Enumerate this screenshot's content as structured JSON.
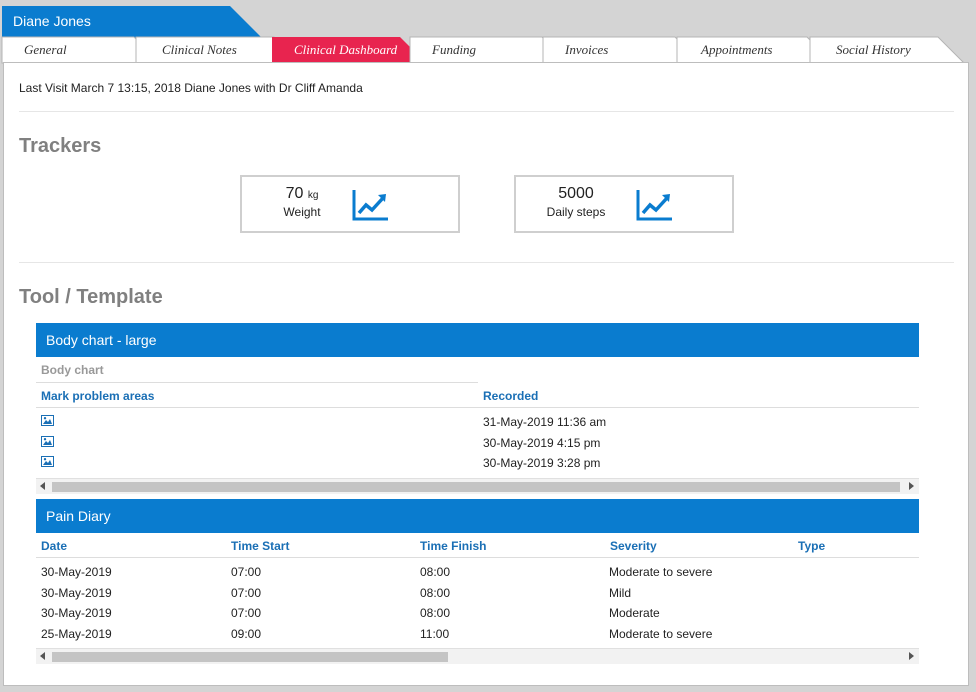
{
  "patient_name": "Diane Jones",
  "tabs": [
    {
      "label": "General",
      "active": false
    },
    {
      "label": "Clinical Notes",
      "active": false
    },
    {
      "label": "Clinical Dashboard",
      "active": true
    },
    {
      "label": "Funding",
      "active": false
    },
    {
      "label": "Invoices",
      "active": false
    },
    {
      "label": "Appointments",
      "active": false
    },
    {
      "label": "Social History",
      "active": false
    }
  ],
  "last_visit": "Last Visit March 7 13:15, 2018 Diane Jones with Dr Cliff Amanda",
  "trackers_title": "Trackers",
  "trackers": [
    {
      "value": "70",
      "unit": "kg",
      "label": "Weight",
      "icon": "line-chart-icon"
    },
    {
      "value": "5000",
      "unit": "",
      "label": "Daily steps",
      "icon": "line-chart-icon"
    }
  ],
  "tool_title": "Tool / Template",
  "body_chart": {
    "header": "Body chart - large",
    "subheader": "Body chart",
    "columns": [
      "Mark problem areas",
      "Recorded"
    ],
    "rows": [
      {
        "icon": "image-icon",
        "recorded": "31-May-2019 11:36 am"
      },
      {
        "icon": "image-icon",
        "recorded": "30-May-2019 4:15 pm"
      },
      {
        "icon": "image-icon",
        "recorded": "30-May-2019 3:28 pm"
      }
    ]
  },
  "pain_diary": {
    "header": "Pain Diary",
    "columns": [
      "Date",
      "Time Start",
      "Time Finish",
      "Severity",
      "Type"
    ],
    "rows": [
      [
        "30-May-2019",
        "07:00",
        "08:00",
        "Moderate to severe",
        ""
      ],
      [
        "30-May-2019",
        "07:00",
        "08:00",
        "Mild",
        ""
      ],
      [
        "30-May-2019",
        "07:00",
        "08:00",
        "Moderate",
        ""
      ],
      [
        "25-May-2019",
        "09:00",
        "11:00",
        "Moderate to severe",
        ""
      ]
    ]
  },
  "colors": {
    "accent": "#0a7ccf",
    "active_tab": "#e8244f",
    "tab_bg": "#ffffff",
    "page_bg": "#d4d4d4"
  }
}
